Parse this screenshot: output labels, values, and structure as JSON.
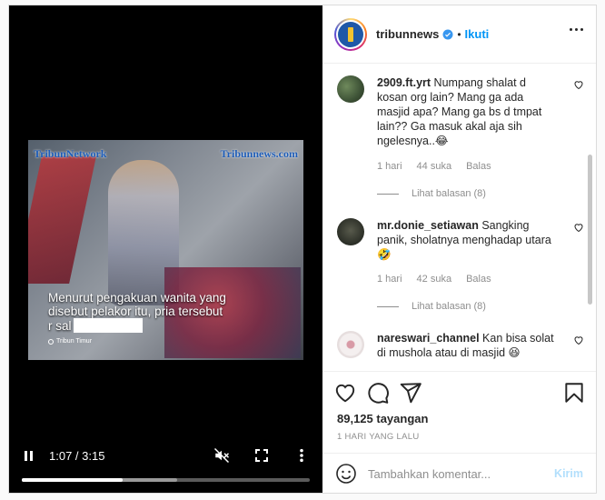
{
  "video": {
    "brand_left": "TribunNetwork",
    "brand_right": "Tribunnews.com",
    "caption_line1": "Menurut pengakuan wanita yang",
    "caption_line2": "disebut pelakor itu, pria tersebut",
    "caption_line3": "r sal",
    "source": "Tribun Timur",
    "time": "1:07 / 3:15",
    "played_fraction": 0.35,
    "buffered_fraction": 0.54,
    "icons": [
      "pause-icon",
      "mute-icon",
      "fullscreen-icon",
      "more-vertical-icon"
    ]
  },
  "header": {
    "username": "tribunnews",
    "bullet": "•",
    "follow_label": "Ikuti"
  },
  "comments": [
    {
      "username": "2909.ft.yrt",
      "text": "Numpang shalat d kosan org lain? Mang ga ada masjid apa? Mang ga bs d tmpat lain?? Ga masuk akal aja sih ngelesnya..😂",
      "time": "1 hari",
      "likes": "44 suka",
      "reply": "Balas",
      "view_replies": "Lihat balasan (8)"
    },
    {
      "username": "mr.donie_setiawan",
      "text": "Sangking panik, sholatnya menghadap utara🤣",
      "time": "1 hari",
      "likes": "42 suka",
      "reply": "Balas",
      "view_replies": "Lihat balasan (8)"
    },
    {
      "username": "nareswari_channel",
      "text": "Kan bisa solat di mushola atau di masjid 😆"
    }
  ],
  "stats": {
    "views": "89,125 tayangan",
    "date": "1 HARI YANG LALU"
  },
  "add_comment": {
    "placeholder": "Tambahkan komentar...",
    "post_label": "Kirim"
  },
  "colors": {
    "accent": "#0095f6",
    "post_disabled": "#b2dffc",
    "muted_text": "#8e8e8e"
  }
}
